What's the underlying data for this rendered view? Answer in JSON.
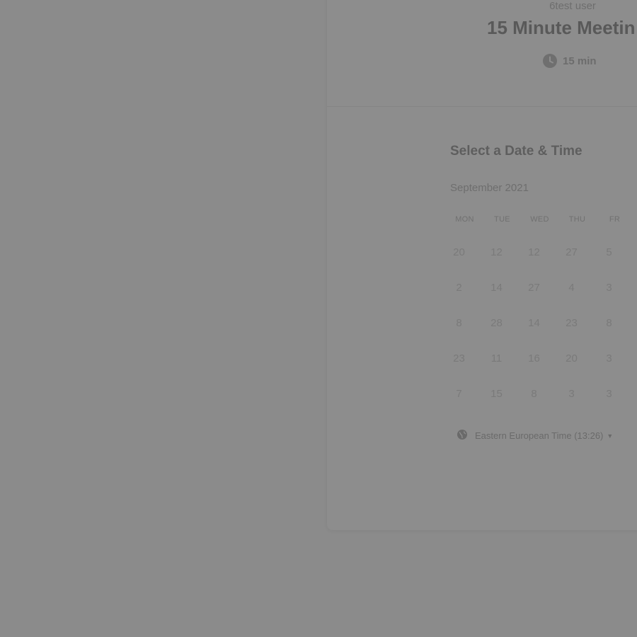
{
  "header": {
    "user_name": "6test user",
    "event_title": "15 Minute Meetin",
    "duration": "15 min"
  },
  "calendar": {
    "section_title": "Select a Date & Time",
    "month_label": "September 2021",
    "weekdays": [
      "MON",
      "TUE",
      "WED",
      "THU",
      "FR"
    ],
    "rows": [
      [
        "20",
        "12",
        "12",
        "27",
        "5"
      ],
      [
        "2",
        "14",
        "27",
        "4",
        "3"
      ],
      [
        "8",
        "28",
        "14",
        "23",
        "8"
      ],
      [
        "23",
        "11",
        "16",
        "20",
        "3"
      ],
      [
        "7",
        "15",
        "8",
        "3",
        "3"
      ]
    ]
  },
  "timezone": {
    "label": "Eastern European Time (13:26)"
  },
  "icons": {
    "clock": "clock-icon",
    "globe": "globe-icon",
    "caret": "caret-down-icon"
  },
  "colors": {
    "overlay_background": "#8b8b8b",
    "card_background": "#8d8d8d"
  }
}
